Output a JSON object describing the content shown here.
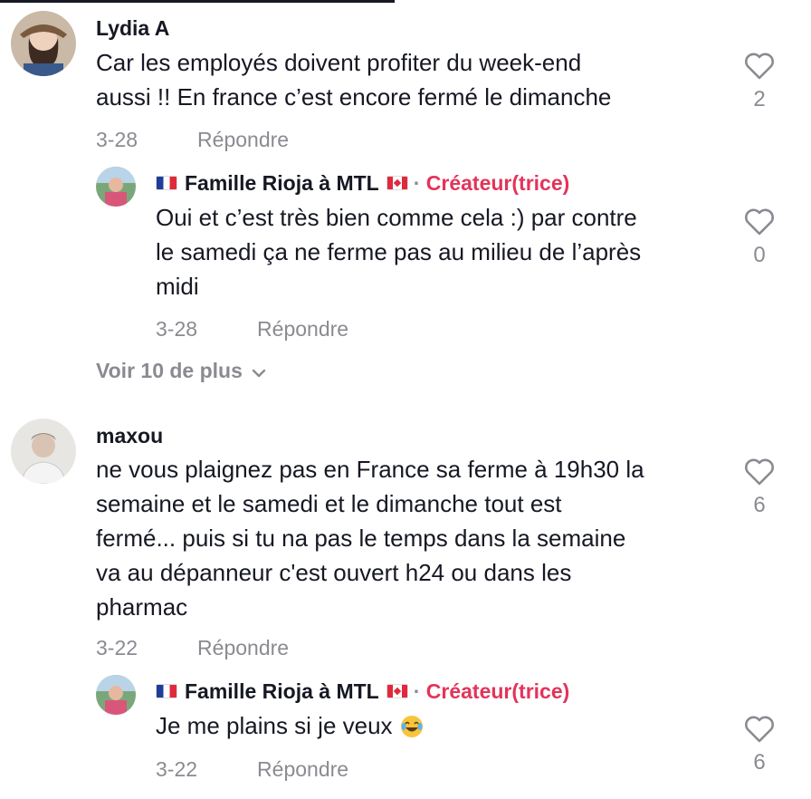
{
  "comments": [
    {
      "username": "Lydia A",
      "text_lines": [
        "Car les employés doivent profiter du week-end",
        "aussi !! En france c’est encore fermé le dimanche"
      ],
      "date": "3-28",
      "reply_label": "Répondre",
      "likes": "2"
    },
    {
      "username": "Famille Rioja à MTL",
      "creator_label": "Créateur(trice)",
      "separator": "·",
      "text_lines": [
        "Oui et c’est très bien comme cela :) par contre",
        "le samedi ça ne ferme pas au milieu de l’après",
        "midi"
      ],
      "date": "3-28",
      "reply_label": "Répondre",
      "likes": "0"
    },
    {
      "view_more": "Voir 10 de plus"
    },
    {
      "username": "maxou",
      "text_lines": [
        "ne vous plaignez pas en France sa ferme à 19h30 la",
        "semaine et le samedi et le dimanche tout est",
        "fermé... puis si tu na pas le temps dans la semaine",
        "va au dépanneur c'est ouvert h24 ou dans les",
        "pharmac"
      ],
      "date": "3-22",
      "reply_label": "Répondre",
      "likes": "6"
    },
    {
      "username": "Famille Rioja à MTL",
      "creator_label": "Créateur(trice)",
      "separator": "·",
      "text": "Je me plains si je veux",
      "emoji": "face-with-tears-of-joy",
      "date": "3-22",
      "reply_label": "Répondre",
      "likes": "6"
    }
  ],
  "colors": {
    "creator": "#e3345a",
    "muted": "#8a8b91",
    "text": "#161823"
  }
}
